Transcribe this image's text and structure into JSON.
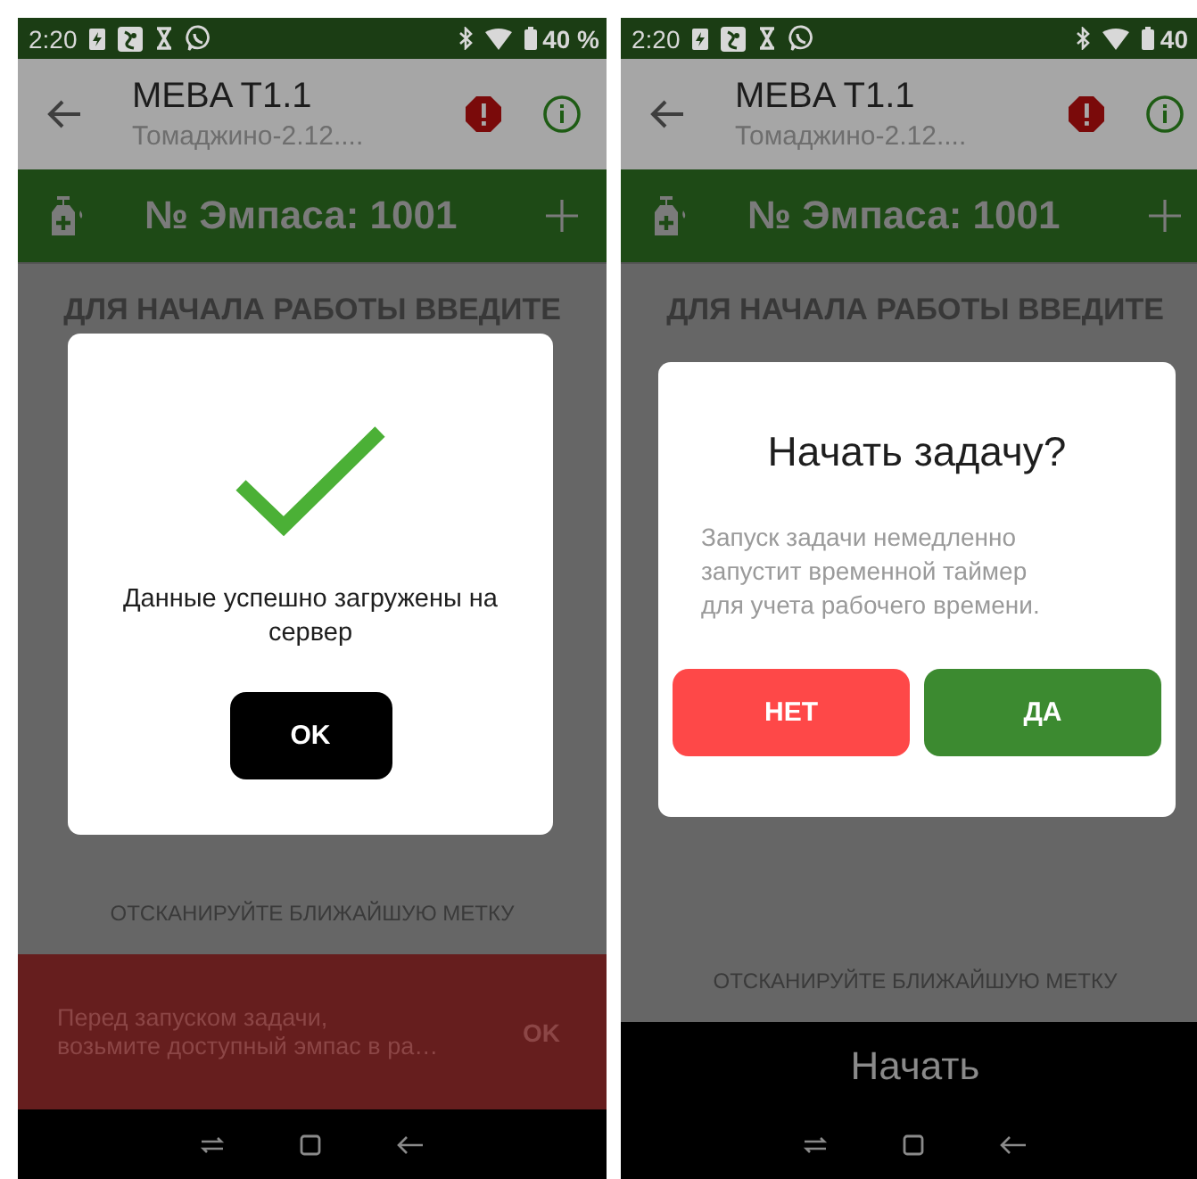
{
  "screens": [
    {
      "status_bar": {
        "time": "2:20",
        "battery": "40 %"
      },
      "toolbar": {
        "title": "MEBA T1.1",
        "subtitle": "Томаджино-2.12...."
      },
      "pass_bar": {
        "label": "№ Эмпаса: 1001"
      },
      "content": {
        "heading": "ДЛЯ НАЧАЛА РАБОТЫ ВВЕДИТЕ",
        "hint": "ОТСКАНИРУЙТЕ БЛИЖАЙШУЮ МЕТКУ"
      },
      "dialog": {
        "kind": "success",
        "message": "Данные успешно загружены на сервер",
        "buttons": [
          {
            "label": "OK",
            "kind": "primary"
          }
        ]
      },
      "snackbar": {
        "message": "Перед запуском задачи,\nвозьмите доступный эмпас в ра…",
        "action": "OK"
      }
    },
    {
      "status_bar": {
        "time": "2:20",
        "battery": "40"
      },
      "toolbar": {
        "title": "MEBA T1.1",
        "subtitle": "Томаджино-2.12...."
      },
      "pass_bar": {
        "label": "№ Эмпаса: 1001"
      },
      "content": {
        "heading": "ДЛЯ НАЧАЛА РАБОТЫ ВВЕДИТЕ",
        "hint": "ОТСКАНИРУЙТЕ БЛИЖАЙШУЮ МЕТКУ"
      },
      "dialog": {
        "kind": "confirm",
        "title": "Начать задачу?",
        "message": "Запуск задачи немедленно\nзапустит временной таймер\nдля учета рабочего времени.",
        "buttons": [
          {
            "label": "НЕТ",
            "kind": "negative"
          },
          {
            "label": "ДА",
            "kind": "positive"
          }
        ]
      },
      "bottom_button": {
        "label": "Начать"
      }
    }
  ]
}
